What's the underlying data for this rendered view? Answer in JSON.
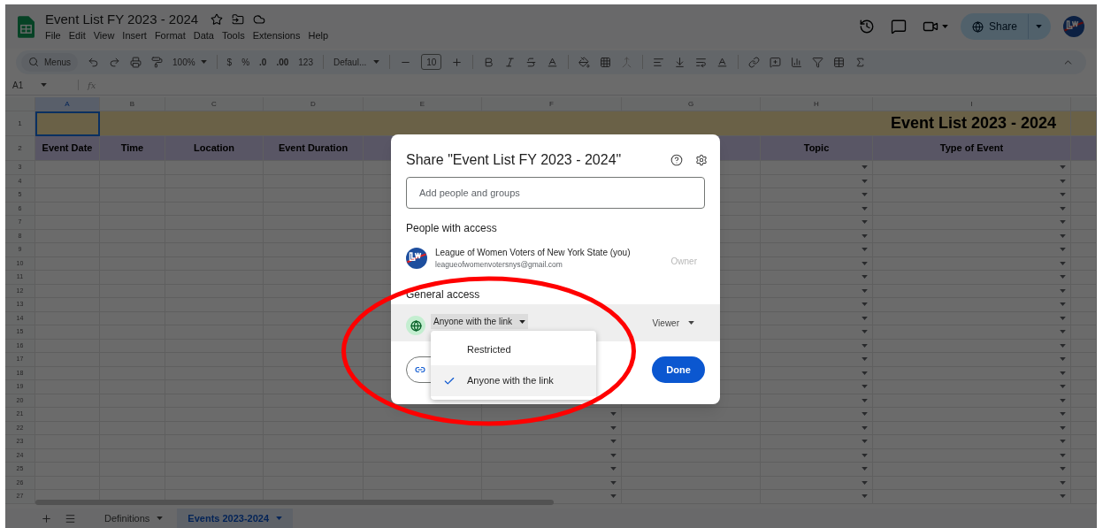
{
  "document": {
    "title": "Event List FY 2023 - 2024"
  },
  "menu_bar": [
    "File",
    "Edit",
    "View",
    "Insert",
    "Format",
    "Data",
    "Tools",
    "Extensions",
    "Help"
  ],
  "share_button": {
    "label": "Share"
  },
  "toolbar": {
    "search": "Menus",
    "zoom": "100%",
    "currency": "$",
    "percent": "%",
    "decrease_decimals": ".0",
    "increase_decimals": ".00",
    "number_format": "123",
    "font": "Defaul...",
    "font_size": "10"
  },
  "formula_bar": {
    "cell_ref": "A1",
    "fx": "fx"
  },
  "grid": {
    "columns": [
      {
        "letter": "A",
        "selected": true,
        "dropdown": false
      },
      {
        "letter": "B",
        "selected": false,
        "dropdown": false
      },
      {
        "letter": "C",
        "selected": false,
        "dropdown": false
      },
      {
        "letter": "D",
        "selected": false,
        "dropdown": false
      },
      {
        "letter": "E",
        "selected": false,
        "dropdown": false
      },
      {
        "letter": "F",
        "selected": false,
        "dropdown": true
      },
      {
        "letter": "G",
        "selected": false,
        "dropdown": false
      },
      {
        "letter": "H",
        "selected": false,
        "dropdown": true
      },
      {
        "letter": "I",
        "selected": false,
        "dropdown": true
      }
    ],
    "title_row": {
      "label": "1",
      "text": "Event List 2023 - 2024"
    },
    "header_row": {
      "label": "2",
      "cells": [
        {
          "text": "Event Date"
        },
        {
          "text": "Time"
        },
        {
          "text": "Location"
        },
        {
          "text": "Event Duration"
        },
        {},
        {},
        {},
        {
          "text": "Topic"
        },
        {
          "text": "Type of Event"
        }
      ]
    },
    "rows": [
      {
        "label": "3"
      },
      {
        "label": "4"
      },
      {
        "label": "5"
      },
      {
        "label": "6"
      },
      {
        "label": "7"
      },
      {
        "label": "8"
      },
      {
        "label": "9"
      },
      {
        "label": "10"
      },
      {
        "label": "11"
      },
      {
        "label": "12"
      },
      {
        "label": "13"
      },
      {
        "label": "14"
      },
      {
        "label": "15"
      },
      {
        "label": "16"
      },
      {
        "label": "17"
      },
      {
        "label": "18"
      },
      {
        "label": "19"
      },
      {
        "label": "20"
      },
      {
        "label": "21"
      },
      {
        "label": "22"
      },
      {
        "label": "23"
      },
      {
        "label": "24"
      },
      {
        "label": "25"
      },
      {
        "label": "26"
      },
      {
        "label": "27"
      }
    ]
  },
  "dialog": {
    "title": "Share \"Event List FY 2023 - 2024\"",
    "add_people": {
      "placeholder": "Add people and groups"
    },
    "people_heading": "People with access",
    "people": [
      {
        "name": "League of Women Voters of New York State (you)",
        "email": "leagueofwomenvotersnys@gmail.com",
        "role": "Owner"
      }
    ],
    "general_heading": "General access",
    "access_select": "Anyone with the link",
    "role_select": "Viewer",
    "access_menu": [
      {
        "label": "Restricted",
        "selected": false
      },
      {
        "label": "Anyone with the link",
        "selected": true
      }
    ],
    "done": "Done"
  },
  "sheet_tabs": [
    {
      "label": "Definitions",
      "selected": false
    },
    {
      "label": "Events 2023-2024",
      "selected": true
    }
  ]
}
